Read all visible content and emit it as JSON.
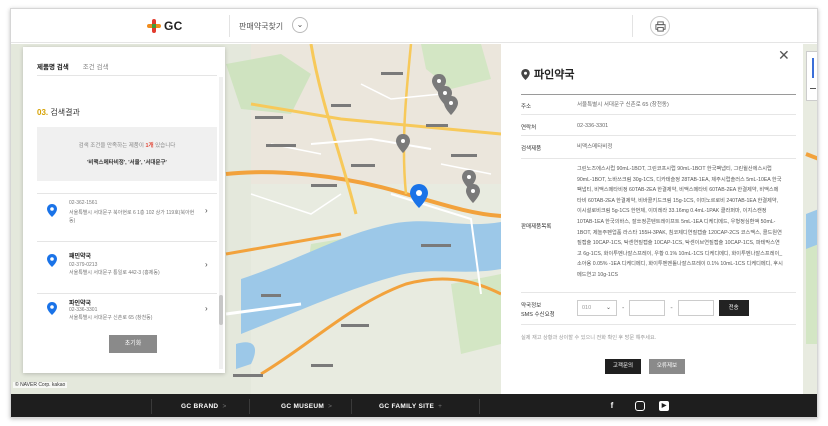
{
  "header": {
    "logo_text": "GC",
    "nav_title": "판매약국찾기",
    "nav_chevron": "⌄",
    "print_icon": "printer-icon"
  },
  "search_panel": {
    "tabs": [
      "제품명 검색",
      "조건 검색"
    ],
    "active_tab": 0,
    "result_number": "03.",
    "result_title": "검색결과",
    "criteria_message": "검색 조건을 만족하는 제품이 ",
    "criteria_count": "1개",
    "criteria_suffix": " 있습니다",
    "criteria_terms": "'비맥스메타비정', '서울', '서대문구'",
    "items": [
      {
        "name": "",
        "tel": "02-362-1561",
        "address": "서울특별시 서대문구 북아현로 6 1층 102 상가 119호(북아현동)"
      },
      {
        "name": "패민약국",
        "tel": "02-379-0213",
        "address": "서울특별시 서대문구 통일로 442-3 (홍제동)"
      },
      {
        "name": "파인약국",
        "tel": "02-336-3301",
        "address": "서울특별시 서대문구 신촌로 65 (창천동)"
      }
    ],
    "reset_label": "초기화"
  },
  "detail": {
    "close_glyph": "✕",
    "title": "파인약국",
    "address_label": "주소",
    "address_value": "서울특별시 서대문구 신촌로 65 (창천동)",
    "tel_label": "연락처",
    "tel_value": "02-336-3301",
    "product_label": "검색제품",
    "product_value": "비맥스메타비정",
    "product_list_label": "판매제품목록",
    "product_list_value": "그린노즈에스시럽 90mL-1BOT, 그린코프시럽 90mL-1BOT 한국팩냅티, 그린윌산에스시럽 90mL-1BOT, 노바쓰크림 30g-1CS, 디카테슬정 28TAB-1EA, 제주시럽솔러스 5mL-10EA 한국팩냅티, 비맥스메타비정 60TAB-2EA 한결제약, 비맥스메타비 60TAB-2EA 한결제약, 비맥스메타비 60TAB-2EA 한결제약, 비바콜키드크림 15g-1CS, 이미노르로비 240TAB-1EA 한결제약, 이시설로비크림 5g-1CS 한번제, 이미레라 33.16mg 0.4mL-1PAK 클라퍼마, 이지스캔정 10TAB-1EA 한국의바스, 잘쏘정콘텐트레이프트 5mL-1EA 디케디메드, 우형정심환액 50mL-1BOT, 제놀주펜업품 라스타 155H-3PAK, 침코제디연질캡슐 120CAP-2CS 코스맥스, 콜드원연질캡슐 10CAP-1CS, 탁센연질캡슐 10CAP-1CS, 탁센이브연질캡슐 10CAP-1CS, 파테막스연고 6g-1CS, 화이투벤나잘스프레이, 우황 0.1% 10mL-1CS 디케디메디, 화이투벤나잘스프레이_소아용 0.05% -1EA 디케디메디, 화이투벤멘톨나잘스프레이 0.1% 10mL-1CS 디케디메디, 후시메드연고 10g-1CS",
    "sms_label_line1": "약국정보",
    "sms_label_line2": "SMS 수신요청",
    "sms_prefix": "010",
    "sms_caret": "⌄",
    "sms_dash": "-",
    "send_label": "전송",
    "notice": "실제 재고 상황과 상이할 수 있으니 전화 확인 후 방문 해주세요.",
    "btn_call": "고객문의",
    "btn_report": "오류제보"
  },
  "map": {
    "credit": "© NAVER Corp. kakao"
  },
  "footer": {
    "links": [
      "GC BRAND",
      "GC MUSEUM",
      "GC FAMILY SITE"
    ],
    "suffixes": [
      ">",
      ">",
      "+"
    ],
    "social": [
      "f",
      "ig",
      "▶"
    ]
  },
  "colors": {
    "accent_blue": "#1a73e8",
    "pin_gray": "#7a7a7a",
    "highlight_red": "#e14b3b",
    "result_yellow": "#d6a100",
    "footer_bg": "#1e1e1e"
  }
}
